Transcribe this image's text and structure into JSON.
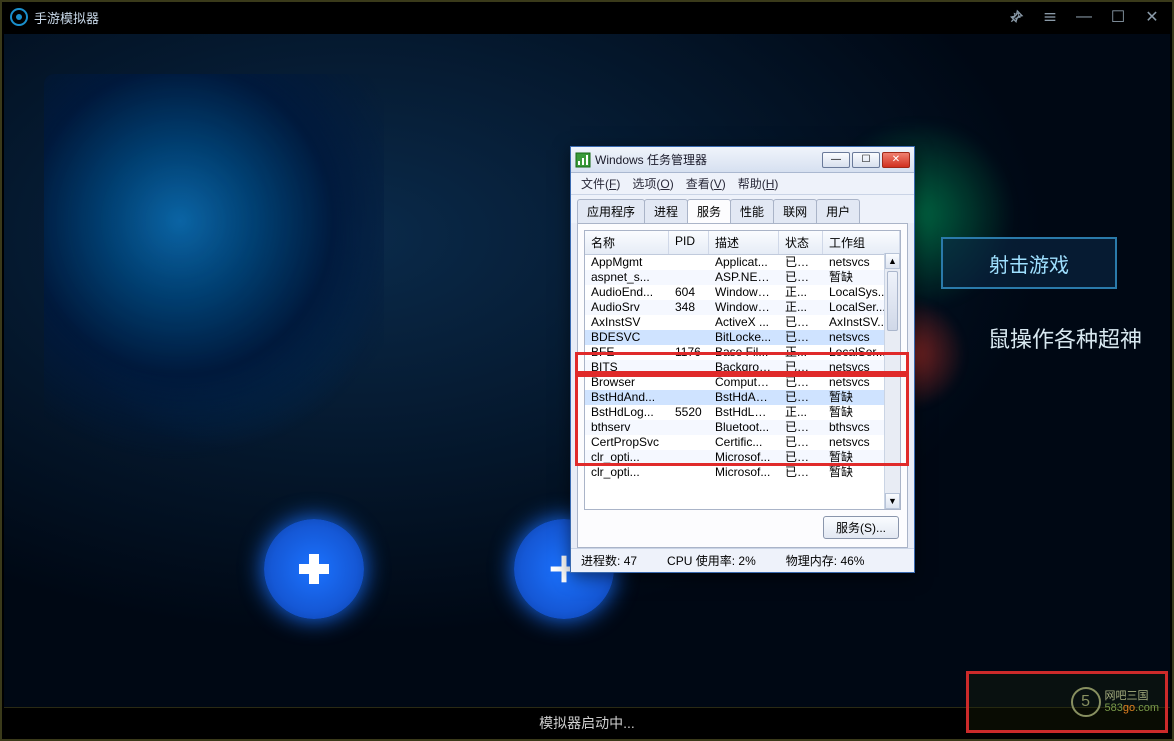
{
  "emulator": {
    "title": "手游模拟器",
    "status_text": "模拟器启动中...",
    "titlebar_icons": {
      "pin": "📌",
      "menu": "☰",
      "min": "—",
      "max": "☐",
      "close": "✕"
    }
  },
  "banner": {
    "button_label": "射击游戏",
    "tagline_suffix": "鼠操作各种超神"
  },
  "watermark": {
    "logo_char": "5",
    "line1": "网吧三国",
    "line2_p1": "583",
    "line2_g": "go",
    "line2_p2": ".com"
  },
  "task_manager": {
    "title": "Windows 任务管理器",
    "menus": [
      {
        "label": "文件",
        "accel": "F"
      },
      {
        "label": "选项",
        "accel": "O"
      },
      {
        "label": "查看",
        "accel": "V"
      },
      {
        "label": "帮助",
        "accel": "H"
      }
    ],
    "tabs": [
      "应用程序",
      "进程",
      "服务",
      "性能",
      "联网",
      "用户"
    ],
    "active_tab": "服务",
    "columns": [
      "名称",
      "PID",
      "描述",
      "状态",
      "工作组"
    ],
    "rows": [
      {
        "name": "AppMgmt",
        "pid": "",
        "desc": "Applicat...",
        "stat": "已停止",
        "group": "netsvcs"
      },
      {
        "name": "aspnet_s...",
        "pid": "",
        "desc": "ASP.NET ...",
        "stat": "已停止",
        "group": "暂缺"
      },
      {
        "name": "AudioEnd...",
        "pid": "604",
        "desc": "Windows ...",
        "stat": "正...",
        "group": "LocalSys..."
      },
      {
        "name": "AudioSrv",
        "pid": "348",
        "desc": "Windows ...",
        "stat": "正...",
        "group": "LocalSer..."
      },
      {
        "name": "AxInstSV",
        "pid": "",
        "desc": "ActiveX ...",
        "stat": "已停止",
        "group": "AxInstSV..."
      },
      {
        "name": "BDESVC",
        "pid": "",
        "desc": "BitLocke...",
        "stat": "已停止",
        "group": "netsvcs",
        "selected": true
      },
      {
        "name": "BFE",
        "pid": "1176",
        "desc": "Base Fil...",
        "stat": "正...",
        "group": "LocalSer..."
      },
      {
        "name": "BITS",
        "pid": "",
        "desc": "Backgrou...",
        "stat": "已停止",
        "group": "netsvcs"
      },
      {
        "name": "Browser",
        "pid": "",
        "desc": "Computer...",
        "stat": "已停止",
        "group": "netsvcs"
      },
      {
        "name": "BstHdAnd...",
        "pid": "",
        "desc": "BstHdAnd...",
        "stat": "已停止",
        "group": "暂缺",
        "selected": true
      },
      {
        "name": "BstHdLog...",
        "pid": "5520",
        "desc": "BstHdLog...",
        "stat": "正...",
        "group": "暂缺"
      },
      {
        "name": "bthserv",
        "pid": "",
        "desc": "Bluetoot...",
        "stat": "已停止",
        "group": "bthsvcs"
      },
      {
        "name": "CertPropSvc",
        "pid": "",
        "desc": "Certific...",
        "stat": "已停止",
        "group": "netsvcs"
      },
      {
        "name": "clr_opti...",
        "pid": "",
        "desc": "Microsof...",
        "stat": "已停止",
        "group": "暂缺"
      },
      {
        "name": "clr_opti...",
        "pid": "",
        "desc": "Microsof...",
        "stat": "已停止",
        "group": "暂缺"
      }
    ],
    "service_button": "服务(S)...",
    "status": {
      "processes_label": "进程数:",
      "processes": "47",
      "cpu_label": "CPU 使用率:",
      "cpu": "2%",
      "mem_label": "物理内存:",
      "mem": "46%"
    }
  }
}
